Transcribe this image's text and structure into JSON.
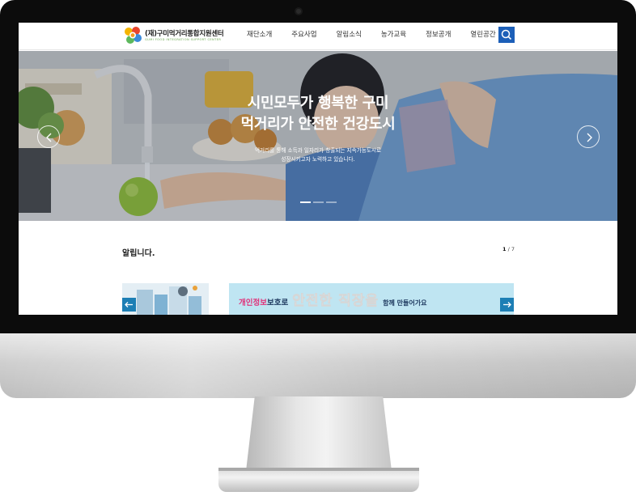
{
  "site": {
    "logo_name": "(재)구미먹거리통합지원센터",
    "logo_sub": "GUMI FOOD INTEGRATION SUPPORT CENTER"
  },
  "nav": {
    "items": [
      "재단소개",
      "주요사업",
      "알림소식",
      "농가교육",
      "정보공개",
      "열린공간"
    ]
  },
  "hero": {
    "title_line1": "시민모두가 행복한 구미",
    "title_line2": "먹거리가 안전한 건강도시",
    "desc_line1": "먹거리를 통해 소득과 일자리가 창출되는 지속가능도시로",
    "desc_line2": "성장시키고자 노력하고 있습니다.",
    "slide_count": 3,
    "active_slide": 1
  },
  "notice": {
    "title": "알립니다.",
    "page_current": "1",
    "page_total": "7"
  },
  "banner": {
    "part1": "개인정보",
    "part2": "보호로",
    "part3": "안전한 직장을",
    "part4": "함께 만들어가요"
  },
  "colors": {
    "accent": "#1c5fb8",
    "banner_arrow": "#1d7fb5",
    "pink": "#e0337a"
  }
}
